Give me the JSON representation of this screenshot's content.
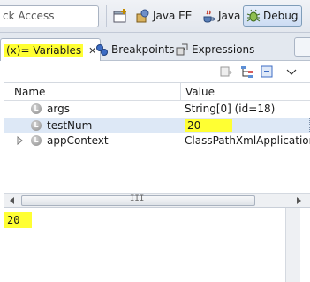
{
  "quick_access": {
    "value": "ck Access"
  },
  "perspectives": [
    {
      "label": "Java EE",
      "icon": "java-ee-icon"
    },
    {
      "label": "Java",
      "icon": "java-icon"
    },
    {
      "label": "Debug",
      "icon": "debug-icon",
      "active": true
    }
  ],
  "tabs": [
    {
      "label": "(x)= Variables",
      "active": true,
      "highlighted": true
    },
    {
      "label": "Breakpoints",
      "icon": "breakpoints-icon"
    },
    {
      "label": "Expressions",
      "icon": "expressions-icon"
    }
  ],
  "columns": {
    "name": "Name",
    "value": "Value"
  },
  "rows": [
    {
      "name": "args",
      "value": "String[0]  (id=18)",
      "icon": "field-icon",
      "icon_letter": "L"
    },
    {
      "name": "testNum",
      "value": "20",
      "icon": "field-icon",
      "icon_letter": "L",
      "selected": true,
      "highlighted": true
    },
    {
      "name": "appContext",
      "value": "ClassPathXmlApplication",
      "icon": "field-icon",
      "icon_letter": "L",
      "expandable": true
    }
  ],
  "scrollbar": {
    "grip": "III"
  },
  "detail": {
    "text": "20"
  },
  "colors": {
    "highlight": "#ffff33",
    "selection": "#dde8f6",
    "chrome": "#e3e8ef"
  }
}
